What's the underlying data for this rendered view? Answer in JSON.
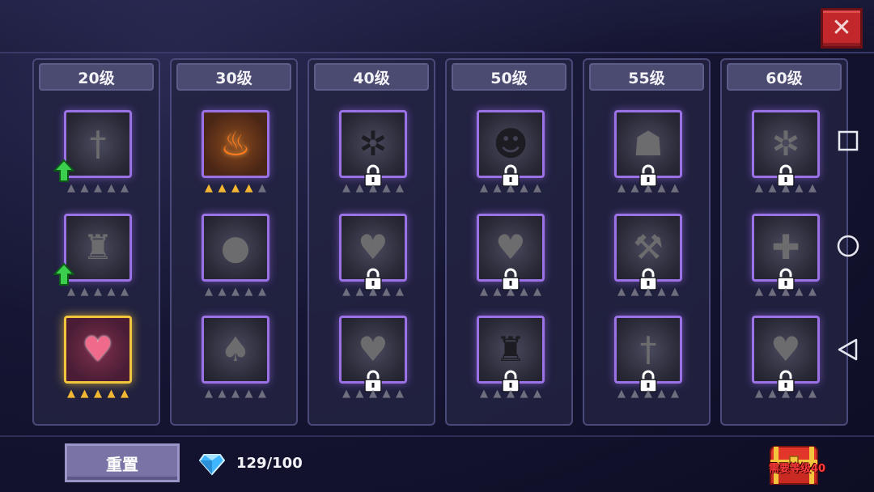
{
  "columns": [
    {
      "level": "20级",
      "slots": [
        {
          "icon": "sword-icon",
          "glyph": "†",
          "locked": false,
          "stars": 0,
          "upgradable": true
        },
        {
          "icon": "armor-icon",
          "glyph": "♜",
          "locked": false,
          "stars": 0,
          "upgradable": true
        },
        {
          "icon": "heart-icon",
          "glyph": "♥",
          "locked": false,
          "stars": 5,
          "selected": true
        }
      ]
    },
    {
      "level": "30级",
      "slots": [
        {
          "icon": "fire-icon",
          "glyph": "♨",
          "locked": false,
          "stars": 4
        },
        {
          "icon": "water-drop-icon",
          "glyph": "●",
          "locked": false,
          "stars": 0
        },
        {
          "icon": "leaf-icon",
          "glyph": "♠",
          "locked": false,
          "stars": 0
        }
      ]
    },
    {
      "level": "40级",
      "slots": [
        {
          "icon": "spider-icon",
          "glyph": "✲",
          "locked": true,
          "stars": 0
        },
        {
          "icon": "heart-plus-icon",
          "glyph": "♥",
          "locked": true,
          "stars": 0
        },
        {
          "icon": "heart-icon",
          "glyph": "♥",
          "locked": true,
          "stars": 0
        }
      ]
    },
    {
      "level": "50级",
      "slots": [
        {
          "icon": "hooded-figure-icon",
          "glyph": "☻",
          "locked": true,
          "stars": 0
        },
        {
          "icon": "heart-plus-icon",
          "glyph": "♥",
          "locked": true,
          "stars": 0
        },
        {
          "icon": "armor-icon",
          "glyph": "♜",
          "locked": true,
          "stars": 0
        }
      ]
    },
    {
      "level": "55级",
      "slots": [
        {
          "icon": "ghost-icon",
          "glyph": "☗",
          "locked": true,
          "stars": 0
        },
        {
          "icon": "hammer-icon",
          "glyph": "⚒",
          "locked": true,
          "stars": 0
        },
        {
          "icon": "sword-icon",
          "glyph": "†",
          "locked": true,
          "stars": 0
        }
      ]
    },
    {
      "level": "60级",
      "slots": [
        {
          "icon": "beetle-icon",
          "glyph": "✲",
          "locked": true,
          "stars": 0
        },
        {
          "icon": "cross-icon",
          "glyph": "✚",
          "locked": true,
          "stars": 0
        },
        {
          "icon": "heart-plus-icon",
          "glyph": "♥",
          "locked": true,
          "stars": 0
        }
      ]
    }
  ],
  "footer": {
    "reset_label": "重置",
    "gems": "129/100",
    "chest_label": "需要等级40"
  },
  "colors": {
    "slot_border": "#9b72e6",
    "selected_border": "#f2c53d",
    "star_on": "#f2b632",
    "close_button": "#c2272b"
  }
}
